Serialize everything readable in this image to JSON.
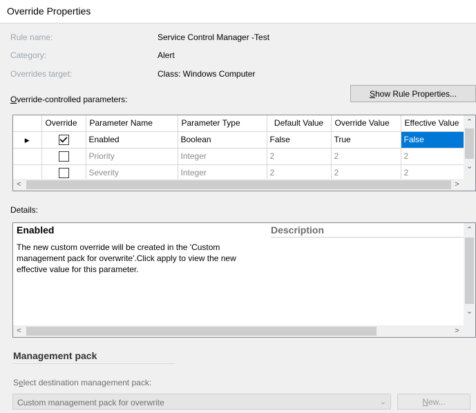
{
  "window": {
    "title": "Override Properties"
  },
  "rule": {
    "name_label": "Rule name:",
    "name_value": "Service Control Manager -Test",
    "category_label": "Category:",
    "category_value": "Alert",
    "target_label": "Overrides target:",
    "target_value": "Class: Windows Computer"
  },
  "params": {
    "label_prefix": "O",
    "label_rest": "verride-controlled parameters:",
    "show_btn_prefix": "S",
    "show_btn_rest": "how Rule Properties..."
  },
  "grid": {
    "columns": [
      "Override",
      "Parameter Name",
      "Parameter Type",
      "Default Value",
      "Override Value",
      "Effective Value"
    ],
    "rows": [
      {
        "checked": true,
        "name": "Enabled",
        "type": "Boolean",
        "default": "False",
        "override": "True",
        "effective": "False"
      },
      {
        "checked": false,
        "name": "Priority",
        "type": "Integer",
        "default": "2",
        "override": "2",
        "effective": "2"
      },
      {
        "checked": false,
        "name": "Severity",
        "type": "Integer",
        "default": "2",
        "override": "2",
        "effective": "2"
      }
    ]
  },
  "details": {
    "label": "Details:",
    "name": "Enabled",
    "description_header": "Description",
    "text_line1": "The new custom override will be created in the 'Custom",
    "text_line2": "management pack for overwrite'.Click apply to view  the new",
    "text_line3": "effective value for this parameter."
  },
  "mp": {
    "heading": "Management pack",
    "select_label_prefix": "S",
    "select_label_mid": "e",
    "select_label_rest": "lect destination management pack:",
    "selected": "Custom management pack for overwrite",
    "new_btn_prefix": "N",
    "new_btn_rest": "ew..."
  }
}
